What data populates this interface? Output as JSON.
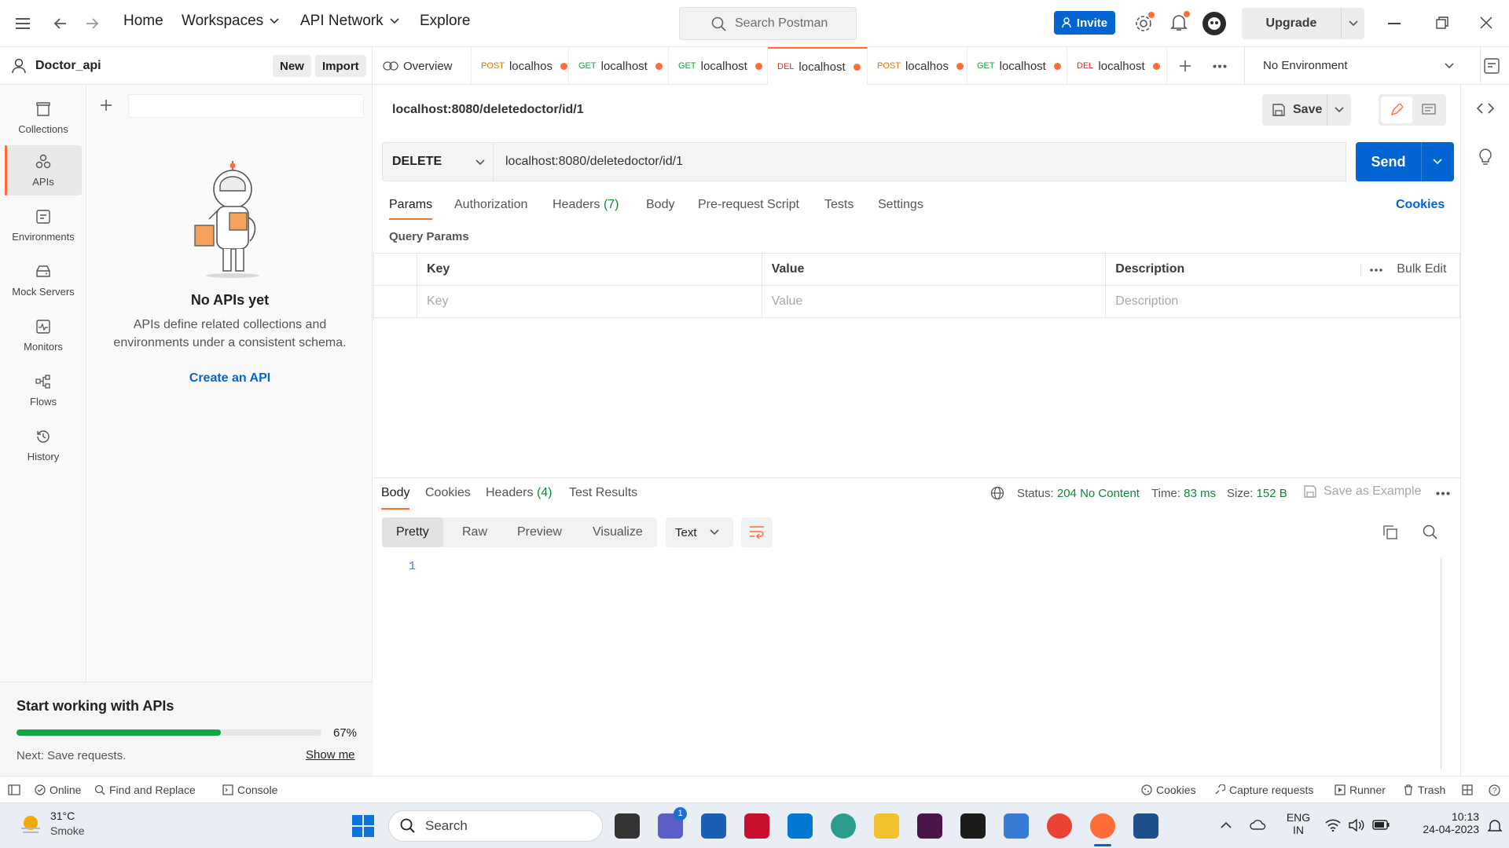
{
  "topbar": {
    "nav": [
      "Home",
      "Workspaces",
      "API Network",
      "Explore"
    ],
    "search_placeholder": "Search Postman",
    "invite_label": "Invite",
    "upgrade_label": "Upgrade"
  },
  "workspace": {
    "name": "Doctor_api",
    "new_label": "New",
    "import_label": "Import"
  },
  "rail": [
    {
      "label": "Collections",
      "icon": "collections-icon"
    },
    {
      "label": "APIs",
      "icon": "apis-icon",
      "active": true
    },
    {
      "label": "Environments",
      "icon": "environments-icon"
    },
    {
      "label": "Mock Servers",
      "icon": "mock-servers-icon"
    },
    {
      "label": "Monitors",
      "icon": "monitors-icon"
    },
    {
      "label": "Flows",
      "icon": "flows-icon"
    },
    {
      "label": "History",
      "icon": "history-icon"
    }
  ],
  "empty_state": {
    "title": "No APIs yet",
    "line1": "APIs define related collections and",
    "line2": "environments under a consistent schema.",
    "cta": "Create an API"
  },
  "promo": {
    "title": "Start working with APIs",
    "progress_pct": "67%",
    "progress_value": 0.67,
    "next": "Next: Save requests.",
    "show_me": "Show me"
  },
  "tabs": [
    {
      "label": "Overview"
    },
    {
      "method": "POST",
      "label": "localhos"
    },
    {
      "method": "GET",
      "label": "localhost"
    },
    {
      "method": "GET",
      "label": "localhost"
    },
    {
      "method": "DEL",
      "label": "localhost",
      "active": true
    },
    {
      "method": "POST",
      "label": "localhos"
    },
    {
      "method": "GET",
      "label": "localhost"
    },
    {
      "method": "DEL",
      "label": "localhost"
    }
  ],
  "environment": "No Environment",
  "request": {
    "title": "localhost:8080/deletedoctor/id/1",
    "save_label": "Save",
    "method": "DELETE",
    "url": "localhost:8080/deletedoctor/id/1",
    "send_label": "Send",
    "tabs": [
      "Params",
      "Authorization",
      "Headers",
      "Body",
      "Pre-request Script",
      "Tests",
      "Settings"
    ],
    "headers_count": "(7)",
    "cookies_label": "Cookies",
    "query_params_label": "Query Params",
    "columns": [
      "Key",
      "Value",
      "Description"
    ],
    "bulk_edit": "Bulk Edit",
    "placeholders": [
      "Key",
      "Value",
      "Description"
    ]
  },
  "response": {
    "tabs": [
      "Body",
      "Cookies",
      "Headers",
      "Test Results"
    ],
    "headers_count": "(4)",
    "status_label": "Status:",
    "status_value": "204 No Content",
    "time_label": "Time:",
    "time_value": "83 ms",
    "size_label": "Size:",
    "size_value": "152 B",
    "save_example": "Save as Example",
    "views": [
      "Pretty",
      "Raw",
      "Preview",
      "Visualize"
    ],
    "format": "Text",
    "line_number": "1"
  },
  "statusbar": {
    "online": "Online",
    "find_replace": "Find and Replace",
    "console": "Console",
    "cookies": "Cookies",
    "capture": "Capture requests",
    "runner": "Runner",
    "trash": "Trash"
  },
  "taskbar": {
    "temp": "31°C",
    "weather": "Smoke",
    "search": "Search",
    "badge": "1",
    "lang1": "ENG",
    "lang2": "IN",
    "time": "10:13",
    "date": "24-04-2023"
  },
  "colors": {
    "accent": "#ff6c37",
    "primary": "#0265d2",
    "status_green": "#0d8a36"
  }
}
